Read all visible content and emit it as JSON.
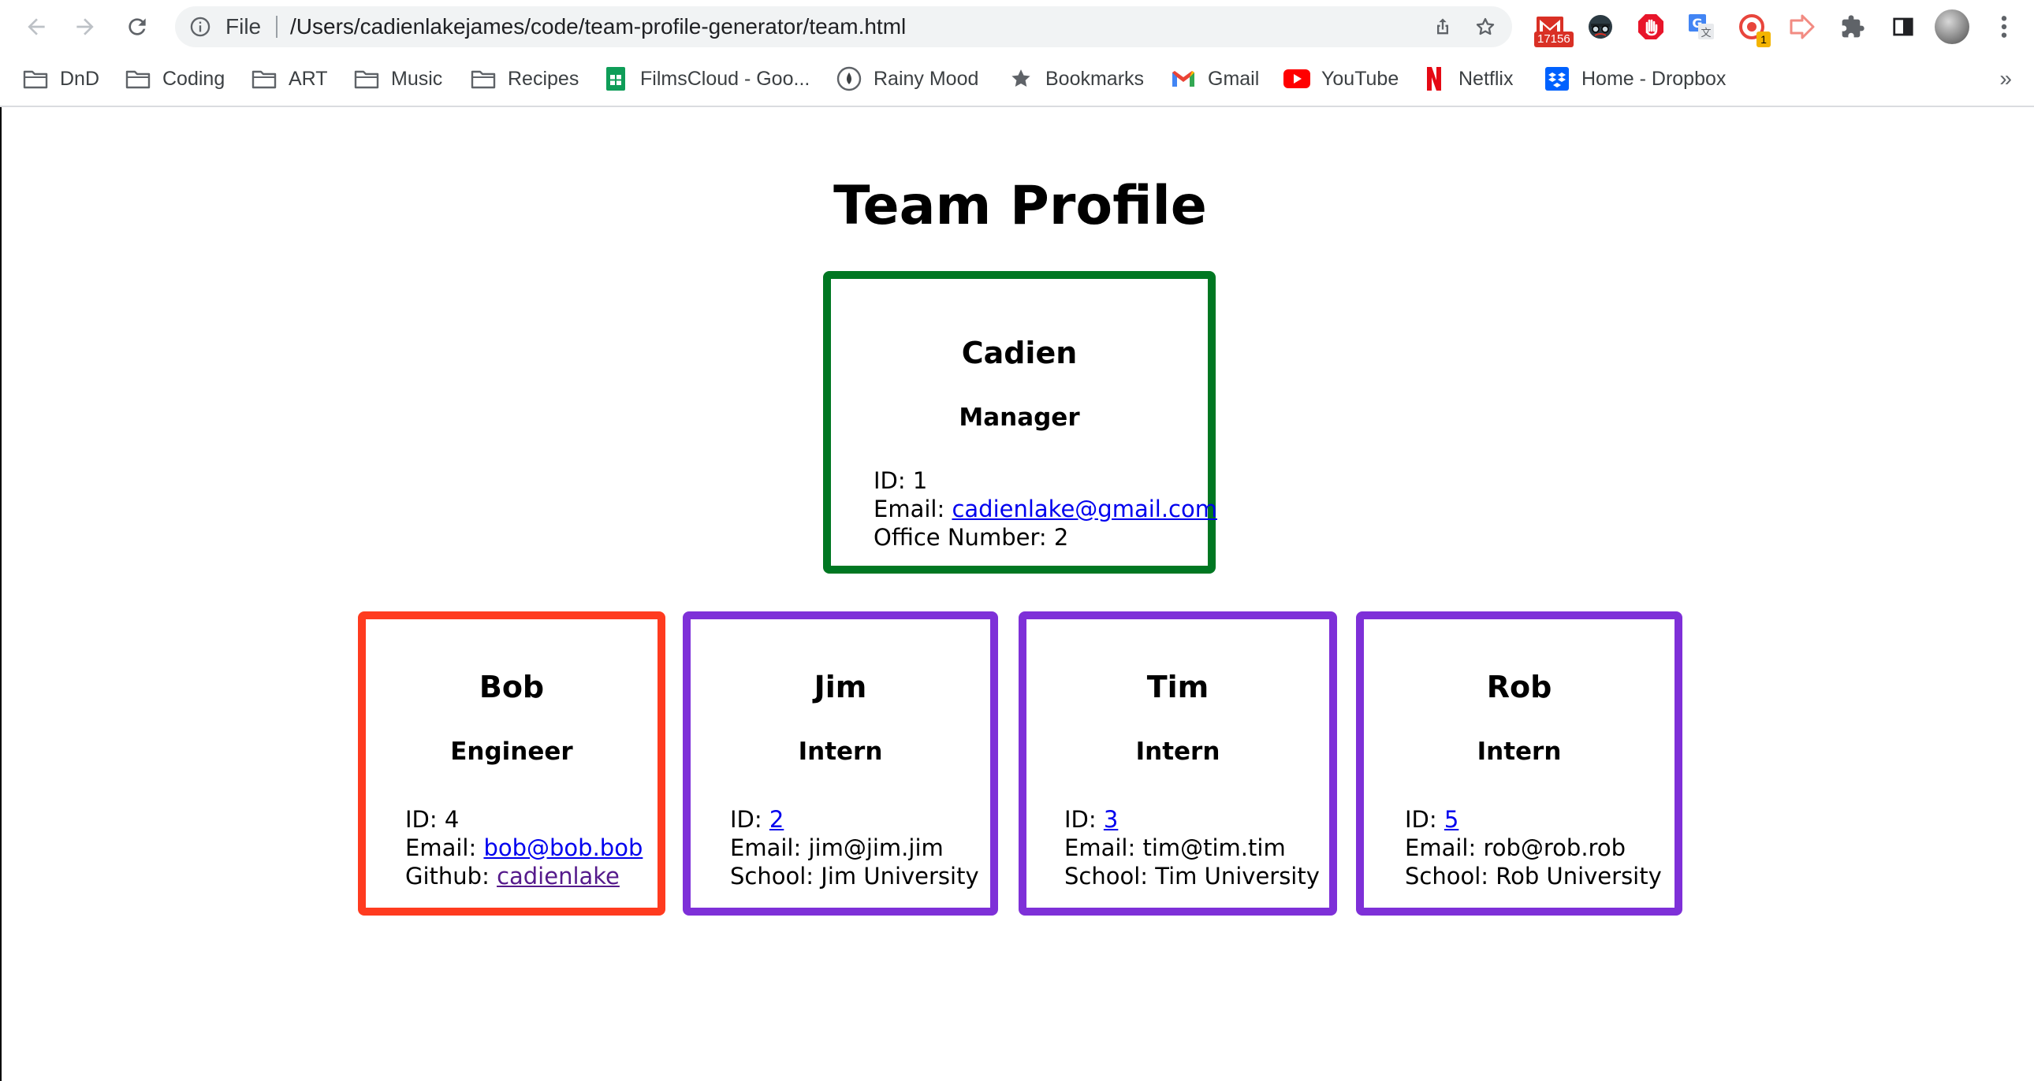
{
  "browser": {
    "omnibox": {
      "scheme_label": "File",
      "url": "/Users/cadienlakejames/code/team-profile-generator/team.html"
    },
    "extensions": [
      {
        "name": "gmail-checker",
        "badge": "17156"
      },
      {
        "name": "spy-extension"
      },
      {
        "name": "adblock"
      },
      {
        "name": "google-translate"
      },
      {
        "name": "record-extension",
        "badge": "1"
      },
      {
        "name": "pointer-extension"
      }
    ],
    "bookmarks": [
      {
        "label": "DnD",
        "icon": "folder-icon"
      },
      {
        "label": "Coding",
        "icon": "folder-icon"
      },
      {
        "label": "ART",
        "icon": "folder-icon"
      },
      {
        "label": "Music",
        "icon": "folder-icon"
      },
      {
        "label": "Recipes",
        "icon": "folder-icon"
      },
      {
        "label": "FilmsCloud - Goo...",
        "icon": "google-sheets-icon"
      },
      {
        "label": "Rainy Mood",
        "icon": "rainy-mood-icon"
      },
      {
        "label": "Bookmarks",
        "icon": "star-icon"
      },
      {
        "label": "Gmail",
        "icon": "gmail-icon"
      },
      {
        "label": "YouTube",
        "icon": "youtube-icon"
      },
      {
        "label": "Netflix",
        "icon": "netflix-icon"
      },
      {
        "label": "Home - Dropbox",
        "icon": "dropbox-icon"
      }
    ],
    "bookmarks_more": "»"
  },
  "page": {
    "title": "Team Profile",
    "colors": {
      "manager": "#007722",
      "engineer": "#ff3b1f",
      "intern": "#7e30d8"
    },
    "manager": {
      "name": "Cadien",
      "role": "Manager",
      "id_label": "ID:",
      "id": "1",
      "email_label": "Email:",
      "email": "cadienlake@gmail.com",
      "office_label": "Office Number:",
      "office": "2"
    },
    "engineer": {
      "name": "Bob",
      "role": "Engineer",
      "id_label": "ID:",
      "id": "4",
      "email_label": "Email:",
      "email": "bob@bob.bob",
      "github_label": "Github:",
      "github": "cadienlake"
    },
    "interns": [
      {
        "name": "Jim",
        "role": "Intern",
        "id_label": "ID:",
        "id": "2",
        "email_label": "Email:",
        "email": "jim@jim.jim",
        "school_label": "School:",
        "school": "Jim University"
      },
      {
        "name": "Tim",
        "role": "Intern",
        "id_label": "ID:",
        "id": "3",
        "email_label": "Email:",
        "email": "tim@tim.tim",
        "school_label": "School:",
        "school": "Tim University"
      },
      {
        "name": "Rob",
        "role": "Intern",
        "id_label": "ID:",
        "id": "5",
        "email_label": "Email:",
        "email": "rob@rob.rob",
        "school_label": "School:",
        "school": "Rob University"
      }
    ]
  }
}
